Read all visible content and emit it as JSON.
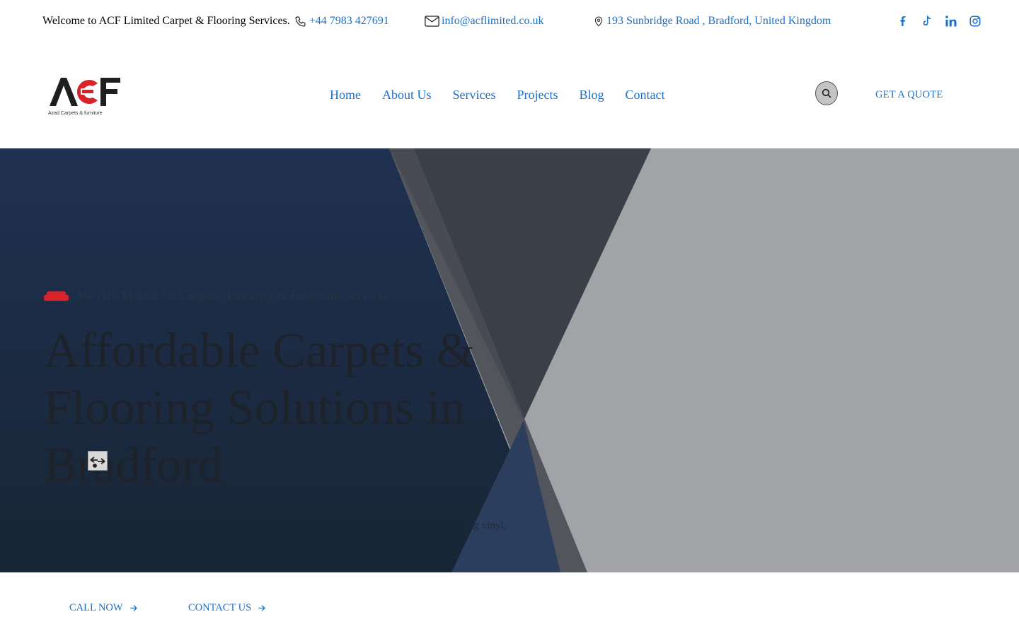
{
  "topbar": {
    "welcome": "Welcome to ACF Limited Carpet & Flooring Services.",
    "phone": "+44 7983 427691",
    "email": "info@acflimited.co.uk",
    "address": "193 Sunbridge Road , Bradford, United Kingdom",
    "socials": [
      {
        "icon": "facebook-icon"
      },
      {
        "icon": "tiktok-icon"
      },
      {
        "icon": "linkedin-icon"
      },
      {
        "icon": "instagram-icon"
      }
    ]
  },
  "header": {
    "logo": {
      "text": "ACF",
      "tagline": "Azad Carpets & furniture"
    },
    "nav": [
      "Home",
      "About Us",
      "Services",
      "Projects",
      "Blog",
      "Contact"
    ],
    "search_icon": "search-icon",
    "quote_label": "GET A QUOTE"
  },
  "hero": {
    "subtitle": "We Are Master Of Carpets, Flooring & Furniture Services",
    "headline": "Affordable Carpets & Flooring Solutions in Bradford",
    "description_visible": "ing vinyl,",
    "colors": {
      "dark_panel": "#1d2d45",
      "wedge": "#3b3f48",
      "right_panel": "#a2a3a6",
      "accent_red": "#d8232a"
    }
  },
  "cta": {
    "call_label": "CALL NOW",
    "contact_label": "CONTACT US"
  },
  "colors": {
    "link": "#1a6fc9",
    "brand_red": "#d8232a"
  }
}
